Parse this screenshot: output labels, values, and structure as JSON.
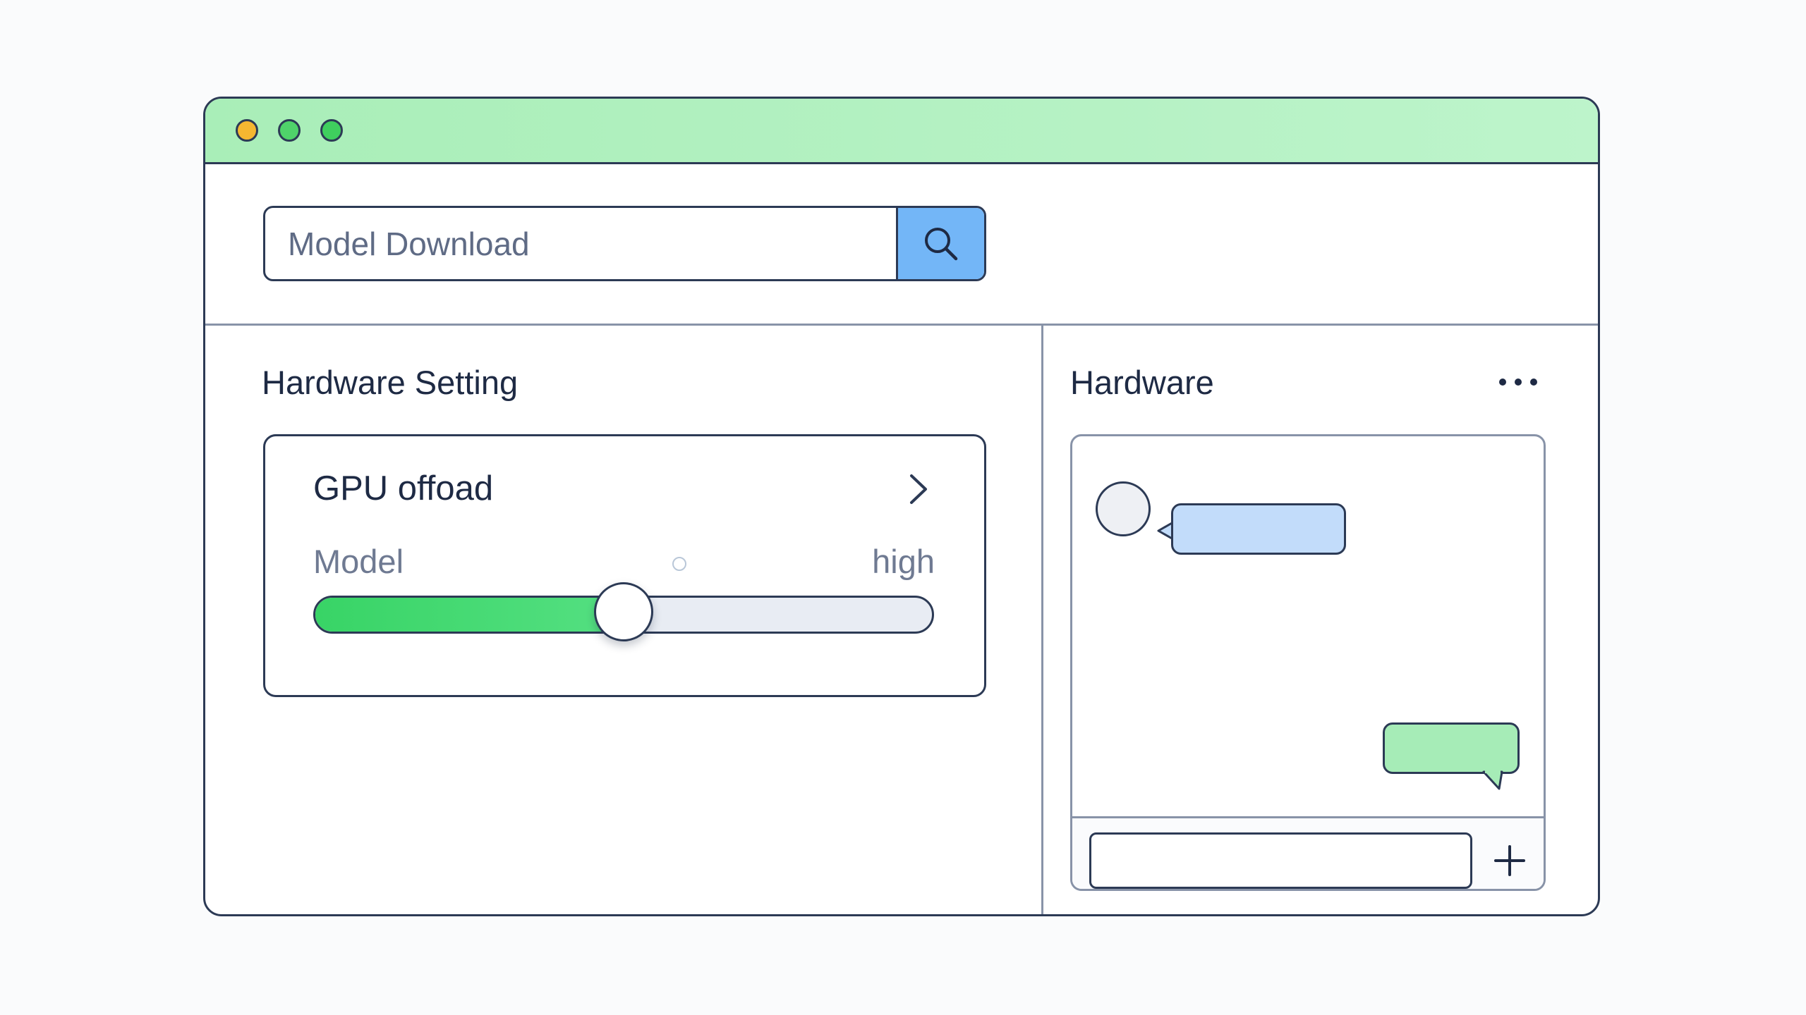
{
  "window": {
    "controls": [
      {
        "name": "close",
        "color": "#f5b731"
      },
      {
        "name": "minimize",
        "color": "#4fd36a"
      },
      {
        "name": "maximize",
        "color": "#3fcf5e"
      }
    ],
    "titlebar_color": "#b5f2c4"
  },
  "search": {
    "placeholder": "Model Download",
    "value": "",
    "button_icon": "search-icon",
    "button_color": "#73b6f7"
  },
  "left_panel": {
    "title": "Hardware Setting",
    "card": {
      "title": "GPU offoad",
      "expand_icon": "chevron-right-icon",
      "slider": {
        "min_label": "Model",
        "max_label": "high",
        "value_fraction": 0.5,
        "fill_color": "#38d466"
      }
    }
  },
  "right_panel": {
    "title": "Hardware",
    "menu_icon": "more-horizontal-icon",
    "chat": {
      "messages": [
        {
          "side": "incoming",
          "text": "",
          "color": "#c2dcfa"
        },
        {
          "side": "outgoing",
          "text": "",
          "color": "#a6ecb7"
        }
      ],
      "input_value": "",
      "add_icon": "plus-icon"
    }
  }
}
